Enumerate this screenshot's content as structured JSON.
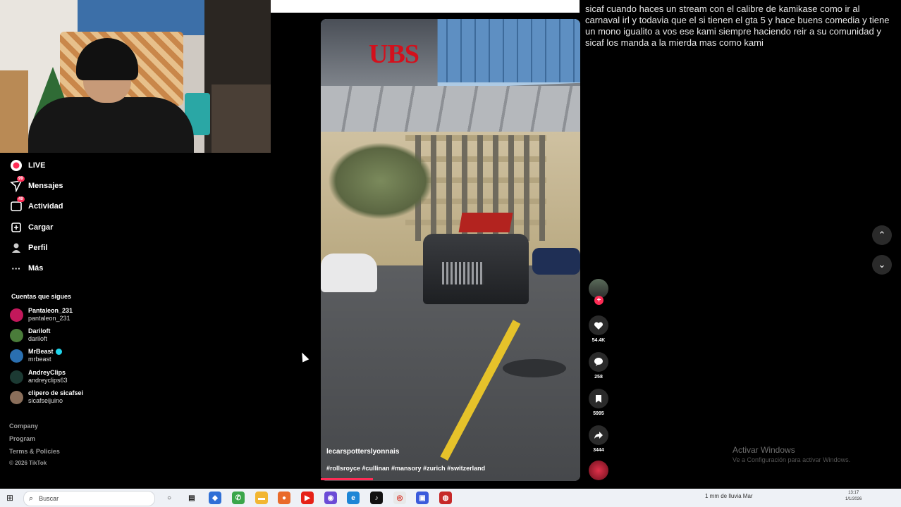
{
  "sidebar": {
    "nav": [
      {
        "label": "LIVE",
        "icon": "live-icon"
      },
      {
        "label": "Mensajes",
        "icon": "messages-icon",
        "badge": "99"
      },
      {
        "label": "Actividad",
        "icon": "activity-icon",
        "badge": "49"
      },
      {
        "label": "Cargar",
        "icon": "upload-icon"
      },
      {
        "label": "Perfil",
        "icon": "profile-icon"
      },
      {
        "label": "Más",
        "icon": "more-icon"
      }
    ],
    "following_title": "Cuentas que sigues",
    "following": [
      {
        "name": "Pantaleon_231",
        "handle": "pantaleon_231",
        "color": "#c2185b"
      },
      {
        "name": "Dariloft",
        "handle": "dariloft",
        "color": "#4a7c3a"
      },
      {
        "name": "MrBeast",
        "handle": "mrbeast",
        "verified": true,
        "color": "#2a6fb0"
      },
      {
        "name": "AndreyClips",
        "handle": "andreyclips63",
        "color": "#234"
      },
      {
        "name": "clipero de sicafsei",
        "handle": "sicafseijuino",
        "color": "#8a6e5a"
      }
    ],
    "footer": [
      "Company",
      "Program",
      "Terms & Policies",
      "© 2026 TikTok"
    ]
  },
  "video": {
    "author": "lecarspotterslyonnais",
    "tags": "#rollsroyce #cullinan #mansory #zurich #switzerland",
    "sign_text": "UBS",
    "progress": 0.2
  },
  "actions": {
    "likes": "54.4K",
    "comments": "258",
    "saves": "5995",
    "shares": "3444"
  },
  "comment_text": "sicaf cuando haces un stream con el calibre de kamikase como ir al carnaval irl y todavia que el si tienen el gta 5 y hace buens comedia y tiene un mono igualito a vos ese kami siempre haciendo reir a su comunidad y sicaf los manda a la mierda mas como kami",
  "watermark": {
    "title": "Activar Windows",
    "subtitle": "Ve a Configuración para activar Windows."
  },
  "taskbar": {
    "search_placeholder": "Buscar",
    "weather": "1 mm de lluvia Mar",
    "time": "13:17",
    "date": "1/1/2026"
  },
  "colors": {
    "accent": "#fe2c55",
    "background": "#000000"
  }
}
